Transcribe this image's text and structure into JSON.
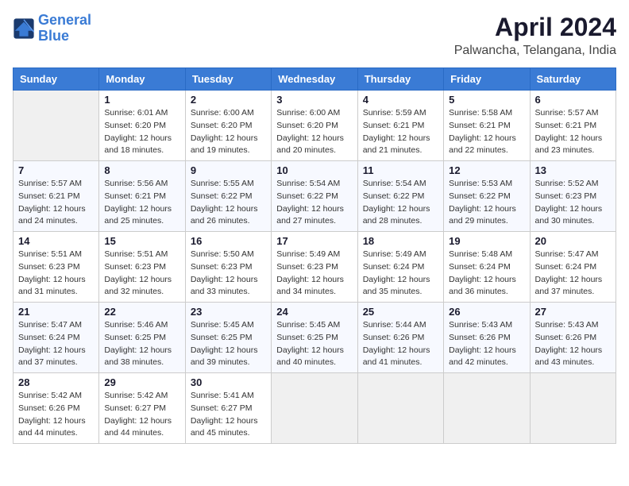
{
  "logo": {
    "line1": "General",
    "line2": "Blue"
  },
  "title": "April 2024",
  "subtitle": "Palwancha, Telangana, India",
  "days_of_week": [
    "Sunday",
    "Monday",
    "Tuesday",
    "Wednesday",
    "Thursday",
    "Friday",
    "Saturday"
  ],
  "weeks": [
    [
      {
        "day": "",
        "info": ""
      },
      {
        "day": "1",
        "info": "Sunrise: 6:01 AM\nSunset: 6:20 PM\nDaylight: 12 hours\nand 18 minutes."
      },
      {
        "day": "2",
        "info": "Sunrise: 6:00 AM\nSunset: 6:20 PM\nDaylight: 12 hours\nand 19 minutes."
      },
      {
        "day": "3",
        "info": "Sunrise: 6:00 AM\nSunset: 6:20 PM\nDaylight: 12 hours\nand 20 minutes."
      },
      {
        "day": "4",
        "info": "Sunrise: 5:59 AM\nSunset: 6:21 PM\nDaylight: 12 hours\nand 21 minutes."
      },
      {
        "day": "5",
        "info": "Sunrise: 5:58 AM\nSunset: 6:21 PM\nDaylight: 12 hours\nand 22 minutes."
      },
      {
        "day": "6",
        "info": "Sunrise: 5:57 AM\nSunset: 6:21 PM\nDaylight: 12 hours\nand 23 minutes."
      }
    ],
    [
      {
        "day": "7",
        "info": "Sunrise: 5:57 AM\nSunset: 6:21 PM\nDaylight: 12 hours\nand 24 minutes."
      },
      {
        "day": "8",
        "info": "Sunrise: 5:56 AM\nSunset: 6:21 PM\nDaylight: 12 hours\nand 25 minutes."
      },
      {
        "day": "9",
        "info": "Sunrise: 5:55 AM\nSunset: 6:22 PM\nDaylight: 12 hours\nand 26 minutes."
      },
      {
        "day": "10",
        "info": "Sunrise: 5:54 AM\nSunset: 6:22 PM\nDaylight: 12 hours\nand 27 minutes."
      },
      {
        "day": "11",
        "info": "Sunrise: 5:54 AM\nSunset: 6:22 PM\nDaylight: 12 hours\nand 28 minutes."
      },
      {
        "day": "12",
        "info": "Sunrise: 5:53 AM\nSunset: 6:22 PM\nDaylight: 12 hours\nand 29 minutes."
      },
      {
        "day": "13",
        "info": "Sunrise: 5:52 AM\nSunset: 6:23 PM\nDaylight: 12 hours\nand 30 minutes."
      }
    ],
    [
      {
        "day": "14",
        "info": "Sunrise: 5:51 AM\nSunset: 6:23 PM\nDaylight: 12 hours\nand 31 minutes."
      },
      {
        "day": "15",
        "info": "Sunrise: 5:51 AM\nSunset: 6:23 PM\nDaylight: 12 hours\nand 32 minutes."
      },
      {
        "day": "16",
        "info": "Sunrise: 5:50 AM\nSunset: 6:23 PM\nDaylight: 12 hours\nand 33 minutes."
      },
      {
        "day": "17",
        "info": "Sunrise: 5:49 AM\nSunset: 6:23 PM\nDaylight: 12 hours\nand 34 minutes."
      },
      {
        "day": "18",
        "info": "Sunrise: 5:49 AM\nSunset: 6:24 PM\nDaylight: 12 hours\nand 35 minutes."
      },
      {
        "day": "19",
        "info": "Sunrise: 5:48 AM\nSunset: 6:24 PM\nDaylight: 12 hours\nand 36 minutes."
      },
      {
        "day": "20",
        "info": "Sunrise: 5:47 AM\nSunset: 6:24 PM\nDaylight: 12 hours\nand 37 minutes."
      }
    ],
    [
      {
        "day": "21",
        "info": "Sunrise: 5:47 AM\nSunset: 6:24 PM\nDaylight: 12 hours\nand 37 minutes."
      },
      {
        "day": "22",
        "info": "Sunrise: 5:46 AM\nSunset: 6:25 PM\nDaylight: 12 hours\nand 38 minutes."
      },
      {
        "day": "23",
        "info": "Sunrise: 5:45 AM\nSunset: 6:25 PM\nDaylight: 12 hours\nand 39 minutes."
      },
      {
        "day": "24",
        "info": "Sunrise: 5:45 AM\nSunset: 6:25 PM\nDaylight: 12 hours\nand 40 minutes."
      },
      {
        "day": "25",
        "info": "Sunrise: 5:44 AM\nSunset: 6:26 PM\nDaylight: 12 hours\nand 41 minutes."
      },
      {
        "day": "26",
        "info": "Sunrise: 5:43 AM\nSunset: 6:26 PM\nDaylight: 12 hours\nand 42 minutes."
      },
      {
        "day": "27",
        "info": "Sunrise: 5:43 AM\nSunset: 6:26 PM\nDaylight: 12 hours\nand 43 minutes."
      }
    ],
    [
      {
        "day": "28",
        "info": "Sunrise: 5:42 AM\nSunset: 6:26 PM\nDaylight: 12 hours\nand 44 minutes."
      },
      {
        "day": "29",
        "info": "Sunrise: 5:42 AM\nSunset: 6:27 PM\nDaylight: 12 hours\nand 44 minutes."
      },
      {
        "day": "30",
        "info": "Sunrise: 5:41 AM\nSunset: 6:27 PM\nDaylight: 12 hours\nand 45 minutes."
      },
      {
        "day": "",
        "info": ""
      },
      {
        "day": "",
        "info": ""
      },
      {
        "day": "",
        "info": ""
      },
      {
        "day": "",
        "info": ""
      }
    ]
  ]
}
